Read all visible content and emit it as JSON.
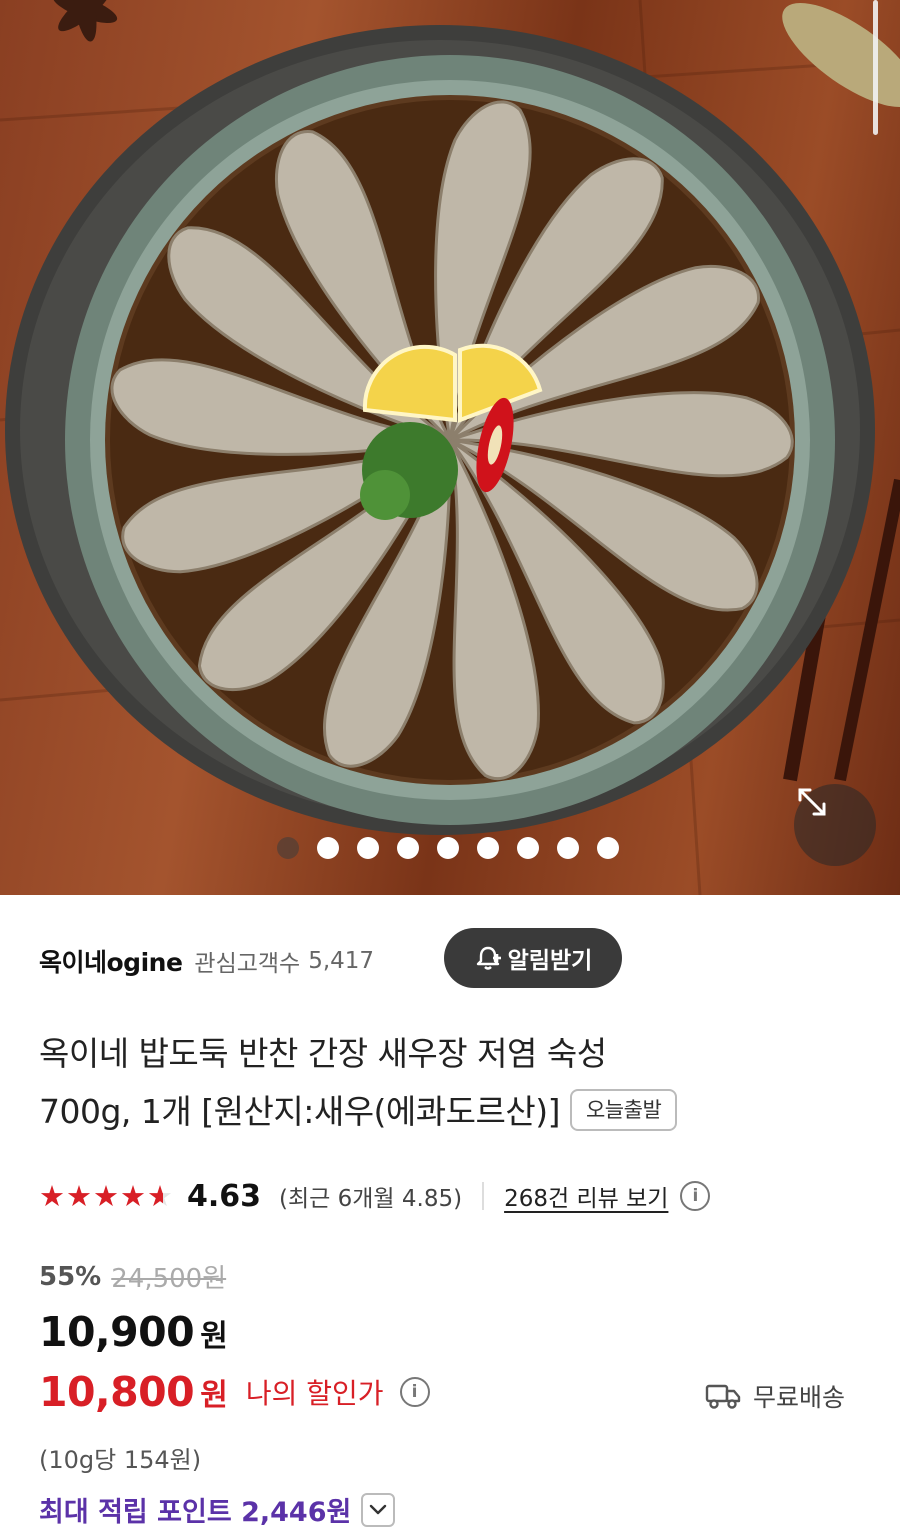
{
  "gallery": {
    "image_count": 9,
    "active_index": 0,
    "expand_icon": "expand-arrows-icon"
  },
  "seller": {
    "name": "옥이네ogine",
    "follower_label": "관심고객수",
    "follower_count": "5,417",
    "alert_label": "알림받기",
    "alert_icon": "bell-plus-icon"
  },
  "product": {
    "title_line1": "옥이네 밥도둑 반찬 간장 새우장 저염 숙성",
    "title_line2": "700g, 1개 [원산지:새우(에콰도르산)]",
    "badge": "오늘출발"
  },
  "rating": {
    "stars": 4.63,
    "score": "4.63",
    "recent": "(최근 6개월 4.85)",
    "review_link": "268건 리뷰 보기",
    "star_color": "#d81f26"
  },
  "price": {
    "discount": "55%",
    "original": "24,500원",
    "price": "10,900",
    "currency": "원",
    "my_price": "10,800",
    "my_currency": "원",
    "my_label": "나의 할인가",
    "shipping": "무료배송",
    "shipping_icon": "truck-icon",
    "unit_price": "(10g당 154원)",
    "points": "최대 적립 포인트 2,446원"
  },
  "colors": {
    "accent_red": "#d81f26",
    "points_purple": "#5b32a8",
    "alert_button": "#3a3a3a"
  }
}
